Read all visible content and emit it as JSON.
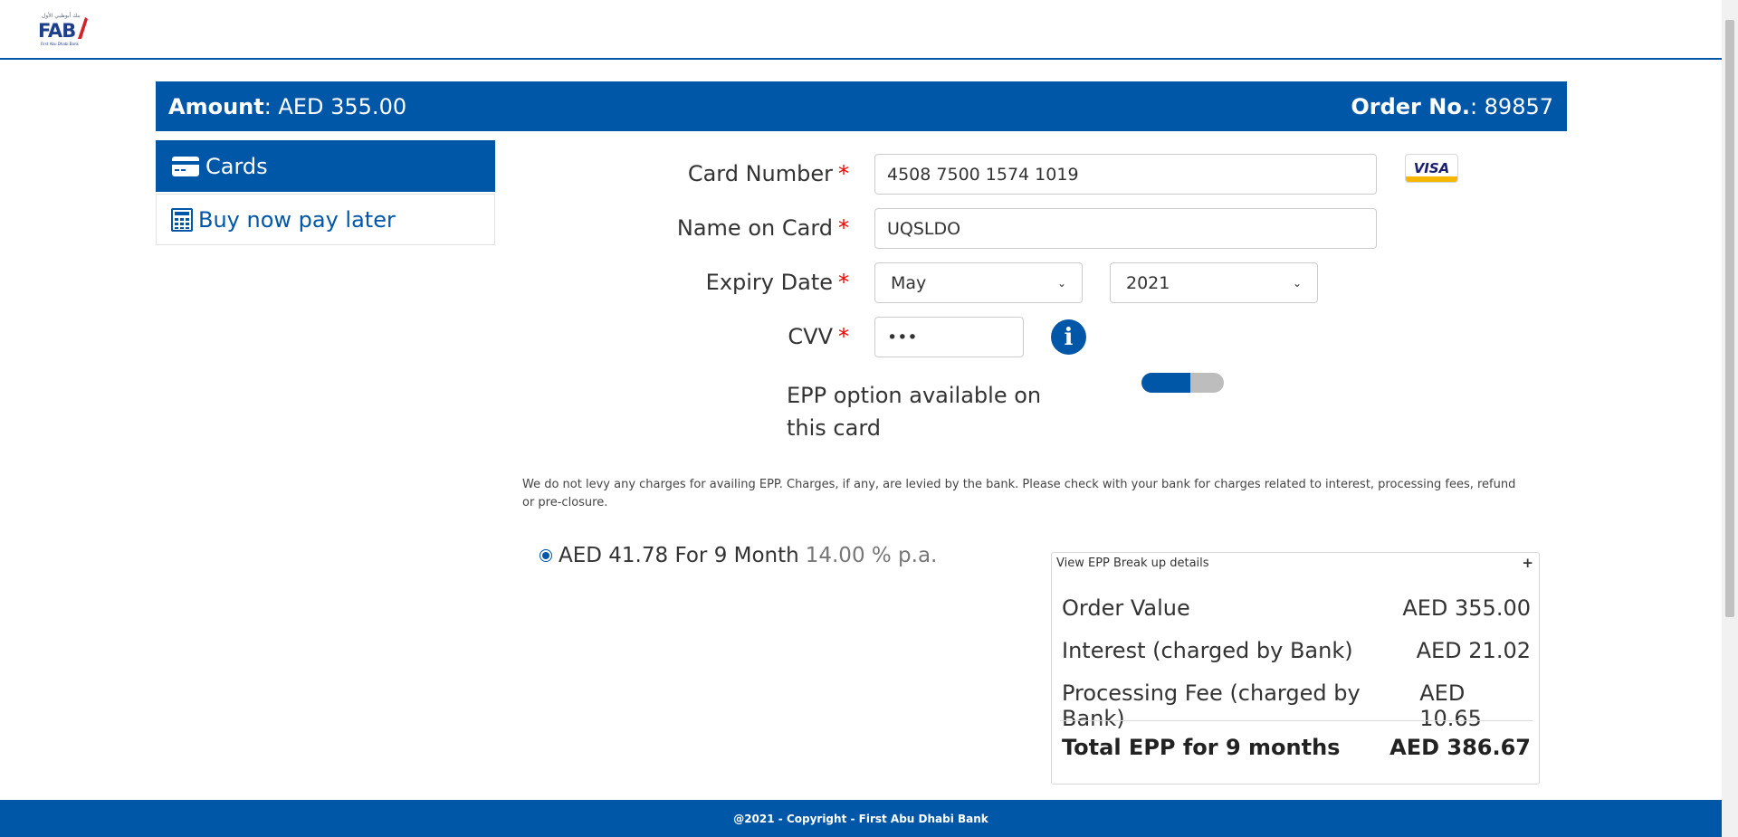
{
  "header": {
    "logo_text": "FAB",
    "logo_arabic": "بنك أبوظبي الأول",
    "logo_subtitle": "First Abu Dhabi Bank"
  },
  "amount_bar": {
    "amount_label": "Amount",
    "amount_value": ": AED 355.00",
    "order_label": "Order No.",
    "order_value": ": 89857"
  },
  "tabs": [
    {
      "label": "Cards",
      "icon": "credit-card-icon",
      "active": true
    },
    {
      "label": "Buy now pay later",
      "icon": "calculator-icon",
      "active": false
    }
  ],
  "form": {
    "card_number_label": "Card Number",
    "card_number_value": "4508 7500 1574 1019",
    "name_label": "Name on Card",
    "name_value": "UQSLDO",
    "expiry_label": "Expiry Date",
    "expiry_month": "May",
    "expiry_year": "2021",
    "cvv_label": "CVV",
    "cvv_value": "•••",
    "required_mark": "*",
    "card_brand": "VISA"
  },
  "epp": {
    "label": "EPP option available on this card",
    "toggle_on": true,
    "disclaimer": "We do not levy any charges for availing EPP. Charges, if any, are levied by the bank. Please check with your bank for charges related to interest, processing fees, refund or pre-closure.",
    "plan_text": "AED 41.78 For 9 Month",
    "plan_rate": "14.00 % p.a.",
    "plan_selected": true
  },
  "breakup": {
    "title": "View EPP Break up details",
    "toggle_symbol": "+",
    "rows": [
      {
        "label": "Order Value",
        "value": "AED 355.00"
      },
      {
        "label": "Interest (charged by Bank)",
        "value": "AED 21.02"
      },
      {
        "label": "Processing Fee (charged by Bank)",
        "value": "AED 10.65"
      }
    ],
    "total_label": "Total EPP for 9 months",
    "total_value": "AED 386.67"
  },
  "footer": {
    "text": "@2021 - Copyright - First Abu Dhabi Bank"
  },
  "colors": {
    "brand_blue": "#0057a8",
    "required_red": "#ee0000",
    "visa_gold": "#f7b600"
  }
}
